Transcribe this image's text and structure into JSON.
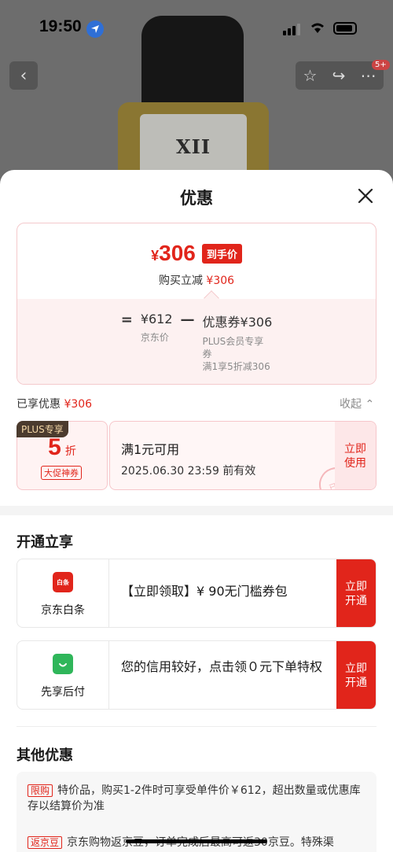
{
  "status_bar": {
    "time": "19:50"
  },
  "bg_page": {
    "watch_numeral": "XII",
    "badge": "5+"
  },
  "sheet": {
    "title": "优惠",
    "price": {
      "currency": "¥",
      "amount": "306",
      "tag": "到手价",
      "sub_prefix": "购买立减 ",
      "sub_value": "¥306"
    },
    "formula": {
      "eq": "=",
      "minus": "—",
      "jd_price": "¥612",
      "jd_label": "京东价",
      "coupon": "优惠券¥306",
      "coupon_note_1": "PLUS会员专享",
      "coupon_note_2": "券",
      "coupon_note_3": "满1享5折减306"
    },
    "enjoyed_label": "已享优惠 ",
    "enjoyed_value": "¥306",
    "collapse": "收起",
    "coupon_card": {
      "plus": "PLUS专享",
      "discount": "5",
      "unit": "折",
      "tag": "大促神券",
      "title": "满1元可用",
      "expiry": "2025.06.30 23:59 前有效",
      "use_l1": "立即",
      "use_l2": "使用",
      "stamp": "已领"
    },
    "open_title": "开通立享",
    "services": [
      {
        "name": "京东白条",
        "icon_text": "白条",
        "text": "【立即领取】¥ 90无门槛券包",
        "btn_l1": "立即",
        "btn_l2": "开通"
      },
      {
        "name": "先享后付",
        "text": "您的信用较好，点击领０元下单特权",
        "btn_l1": "立即",
        "btn_l2": "开通"
      }
    ],
    "other_title": "其他优惠",
    "others": [
      {
        "tag": "限购",
        "text": "特价品，购买1-2件时可享受单件价￥612，超出数量或优惠库存以结算价为准"
      },
      {
        "tag": "返京豆",
        "text": "京东购物返京豆，订单完成后最高可返30京豆。特殊渠"
      }
    ]
  },
  "colors": {
    "accent": "#e1251b",
    "sheet_bg": "#ffffff",
    "card_border": "#f4c9cc"
  },
  "icons": [
    "location-arrow-icon",
    "back-chevron-icon",
    "star-icon",
    "share-icon",
    "more-icon",
    "close-icon",
    "chevron-up-icon",
    "baitiao-icon",
    "shopping-bag-icon"
  ]
}
